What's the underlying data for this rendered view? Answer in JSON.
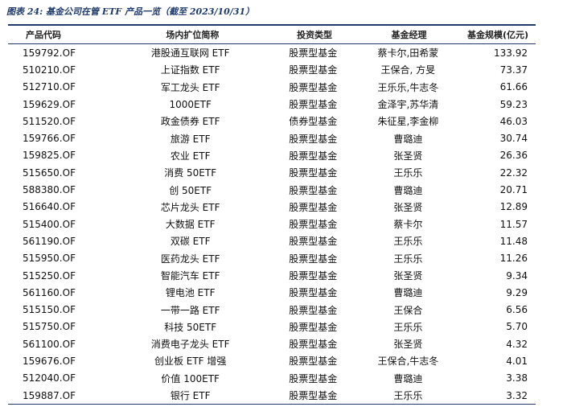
{
  "caption": "图表 24:  基金公司在管 ETF 产品一览（截至 2023/10/31）",
  "table": {
    "headers": {
      "code": "产品代码",
      "name": "场内扩位简称",
      "type": "投资类型",
      "manager": "基金经理",
      "size": "基金规模(亿元)"
    },
    "rows": [
      {
        "code": "159792.OF",
        "name": "港股通互联网 ETF",
        "type": "股票型基金",
        "manager": "蔡卡尔,田希蒙",
        "size": "133.92"
      },
      {
        "code": "510210.OF",
        "name": "上证指数 ETF",
        "type": "股票型基金",
        "manager": "王保合, 方旻",
        "size": "73.37"
      },
      {
        "code": "512710.OF",
        "name": "军工龙头 ETF",
        "type": "股票型基金",
        "manager": "王乐乐,牛志冬",
        "size": "61.66"
      },
      {
        "code": "159629.OF",
        "name": "1000ETF",
        "type": "股票型基金",
        "manager": "金泽宇,苏华清",
        "size": "59.23"
      },
      {
        "code": "511520.OF",
        "name": "政金债券 ETF",
        "type": "债券型基金",
        "manager": "朱征星,李金柳",
        "size": "46.03"
      },
      {
        "code": "159766.OF",
        "name": "旅游 ETF",
        "type": "股票型基金",
        "manager": "曹璐迪",
        "size": "30.74"
      },
      {
        "code": "159825.OF",
        "name": "农业 ETF",
        "type": "股票型基金",
        "manager": "张圣贤",
        "size": "26.36"
      },
      {
        "code": "515650.OF",
        "name": "消费 50ETF",
        "type": "股票型基金",
        "manager": "王乐乐",
        "size": "22.32"
      },
      {
        "code": "588380.OF",
        "name": "创 50ETF",
        "type": "股票型基金",
        "manager": "曹璐迪",
        "size": "20.71"
      },
      {
        "code": "516640.OF",
        "name": "芯片龙头 ETF",
        "type": "股票型基金",
        "manager": "张圣贤",
        "size": "12.89"
      },
      {
        "code": "515400.OF",
        "name": "大数据 ETF",
        "type": "股票型基金",
        "manager": "蔡卡尔",
        "size": "11.57"
      },
      {
        "code": "561190.OF",
        "name": "双碳 ETF",
        "type": "股票型基金",
        "manager": "王乐乐",
        "size": "11.48"
      },
      {
        "code": "515950.OF",
        "name": "医药龙头 ETF",
        "type": "股票型基金",
        "manager": "王乐乐",
        "size": "11.26"
      },
      {
        "code": "515250.OF",
        "name": "智能汽车 ETF",
        "type": "股票型基金",
        "manager": "张圣贤",
        "size": "9.34"
      },
      {
        "code": "561160.OF",
        "name": "锂电池 ETF",
        "type": "股票型基金",
        "manager": "曹璐迪",
        "size": "9.29"
      },
      {
        "code": "515150.OF",
        "name": "一带一路 ETF",
        "type": "股票型基金",
        "manager": "王保合",
        "size": "6.56"
      },
      {
        "code": "515750.OF",
        "name": "科技 50ETF",
        "type": "股票型基金",
        "manager": "王乐乐",
        "size": "5.70"
      },
      {
        "code": "561100.OF",
        "name": "消费电子龙头 ETF",
        "type": "股票型基金",
        "manager": "张圣贤",
        "size": "4.32"
      },
      {
        "code": "159676.OF",
        "name": "创业板 ETF 增强",
        "type": "股票型基金",
        "manager": "王保合,牛志冬",
        "size": "4.01"
      },
      {
        "code": "512040.OF",
        "name": "价值 100ETF",
        "type": "股票型基金",
        "manager": "曹璐迪",
        "size": "3.38"
      },
      {
        "code": "159887.OF",
        "name": "银行 ETF",
        "type": "股票型基金",
        "manager": "王乐乐",
        "size": "3.32"
      }
    ]
  }
}
